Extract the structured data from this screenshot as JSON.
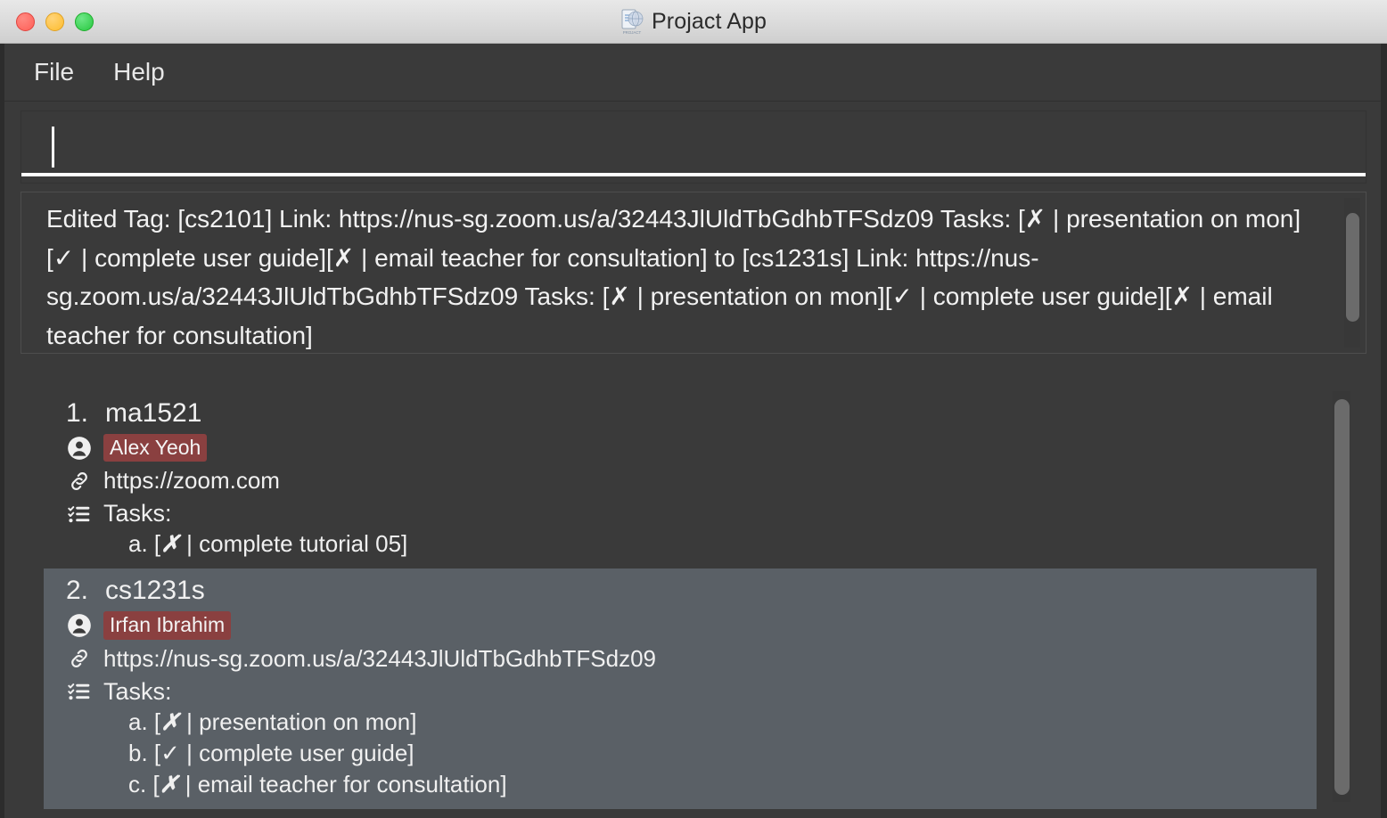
{
  "window": {
    "title": "Projact App",
    "app_icon": "projact-logo-icon",
    "controls": {
      "close": "close-window-button",
      "minimize": "minimize-window-button",
      "maximize": "maximize-window-button"
    },
    "colors": {
      "titlebar": "#dcdcdc",
      "body_bg": "#3a3a3a",
      "selected_row": "#5a6066",
      "badge": "#8a4040",
      "scrollbar_thumb": "#6b6b6b",
      "text": "#f0f0f0",
      "close_light": "#ff5f57",
      "minimize_light": "#febc2e",
      "maximize_light": "#28c840"
    }
  },
  "menubar": {
    "items": [
      {
        "label": "File"
      },
      {
        "label": "Help"
      }
    ]
  },
  "command": {
    "value": "",
    "placeholder": ""
  },
  "result": {
    "text": "Edited Tag: [cs2101] Link: https://nus-sg.zoom.us/a/32443JlUldTbGdhbTFSdz09 Tasks: [✗ | presentation on mon][✓ | complete user guide][✗ | email teacher for consultation] to [cs1231s] Link: https://nus-sg.zoom.us/a/32443JlUldTbGdhbTFSdz09 Tasks: [✗ | presentation on mon][✓ | complete user guide][✗ | email teacher for consultation]"
  },
  "list": {
    "items": [
      {
        "index": "1.",
        "tag": "ma1521",
        "person_icon": "person-icon",
        "person": "Alex Yeoh",
        "link_icon": "link-icon",
        "link": "https://zoom.com",
        "tasks_icon": "checklist-icon",
        "tasks_label": "Tasks:",
        "tasks": [
          {
            "letter": "a.",
            "mark": "✗",
            "text": "complete tutorial 05"
          }
        ],
        "selected": false
      },
      {
        "index": "2.",
        "tag": "cs1231s",
        "person_icon": "person-icon",
        "person": "Irfan Ibrahim",
        "link_icon": "link-icon",
        "link": "https://nus-sg.zoom.us/a/32443JlUldTbGdhbTFSdz09",
        "tasks_icon": "checklist-icon",
        "tasks_label": "Tasks:",
        "tasks": [
          {
            "letter": "a.",
            "mark": "✗",
            "text": "presentation on mon"
          },
          {
            "letter": "b.",
            "mark": "✓",
            "text": "complete user guide"
          },
          {
            "letter": "c.",
            "mark": "✗",
            "text": "email teacher for consultation"
          }
        ],
        "selected": true
      }
    ]
  }
}
